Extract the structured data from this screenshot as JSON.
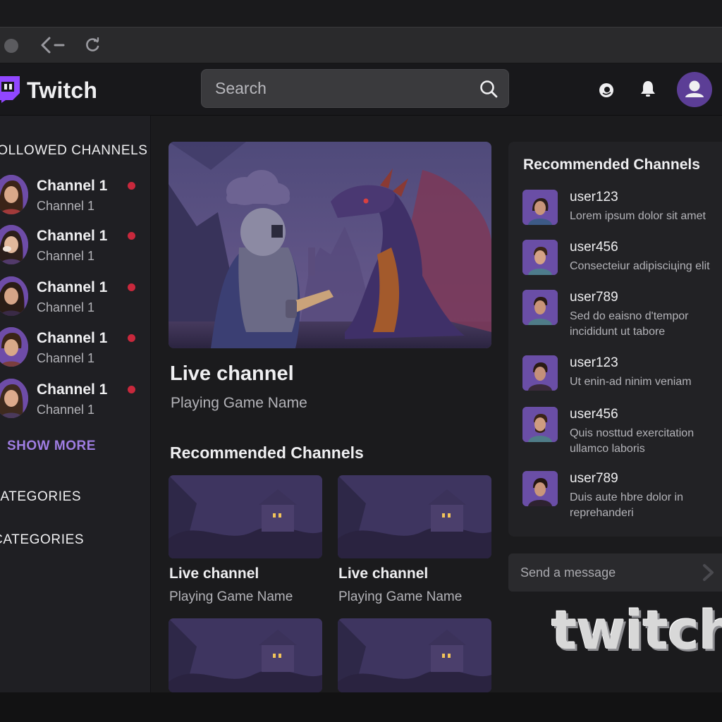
{
  "app": {
    "name": "Twitch"
  },
  "colors": {
    "accent": "#9147ff",
    "live": "#c8283c",
    "link": "#9f7de2",
    "background": "#1b1b1d"
  },
  "browser": {
    "icons": [
      "window-dot-icon",
      "back-arrow-icon",
      "reload-icon"
    ]
  },
  "header": {
    "logo_text": "Twitch",
    "search": {
      "placeholder": "Search",
      "value": ""
    },
    "icons": [
      "search-icon",
      "prime-crown-icon",
      "bell-icon",
      "user-avatar-icon"
    ]
  },
  "sidebar": {
    "followed_heading": "FOLLOWED CHANNELS",
    "channels": [
      {
        "name": "Channel 1",
        "sub": "Channel 1",
        "live": true
      },
      {
        "name": "Channel 1",
        "sub": "Channel 1",
        "live": true
      },
      {
        "name": "Channel 1",
        "sub": "Channel 1",
        "live": true
      },
      {
        "name": "Channel 1",
        "sub": "Channel 1",
        "live": true
      },
      {
        "name": "Channel 1",
        "sub": "Channel 1",
        "live": true
      }
    ],
    "show_more": "SHOW MORE",
    "categories_heading_1": "CATEGORIES",
    "categories_heading_2": "CATEGORIES"
  },
  "main": {
    "hero": {
      "title": "Live channel",
      "subtitle": "Playing Game Name"
    },
    "section_title": "Recommended Channels",
    "cards": [
      {
        "title": "Live channel",
        "subtitle": "Playing Game Name"
      },
      {
        "title": "Live channel",
        "subtitle": "Playing Game Name"
      },
      {
        "title": "",
        "subtitle": ""
      },
      {
        "title": "",
        "subtitle": ""
      }
    ]
  },
  "right_panel": {
    "title": "Recommended Channels",
    "items": [
      {
        "user": "user123",
        "message": "Lorem ipsum dolor sit amet"
      },
      {
        "user": "user456",
        "message": "Consecteiur adipisciцing elit"
      },
      {
        "user": "user789",
        "message": "Sed do eaisno d'tempor\nincididunt ut tabore"
      },
      {
        "user": "user123",
        "message": "Ut enin-ad ninim veniam"
      },
      {
        "user": "user456",
        "message": "Quis nosttud exercitation\nullamco laboris"
      },
      {
        "user": "user789",
        "message": "Duis aute hbre dolor in\nreprehanderi"
      }
    ]
  },
  "chat": {
    "placeholder": "Send a message",
    "value": ""
  },
  "watermark": "twitch"
}
